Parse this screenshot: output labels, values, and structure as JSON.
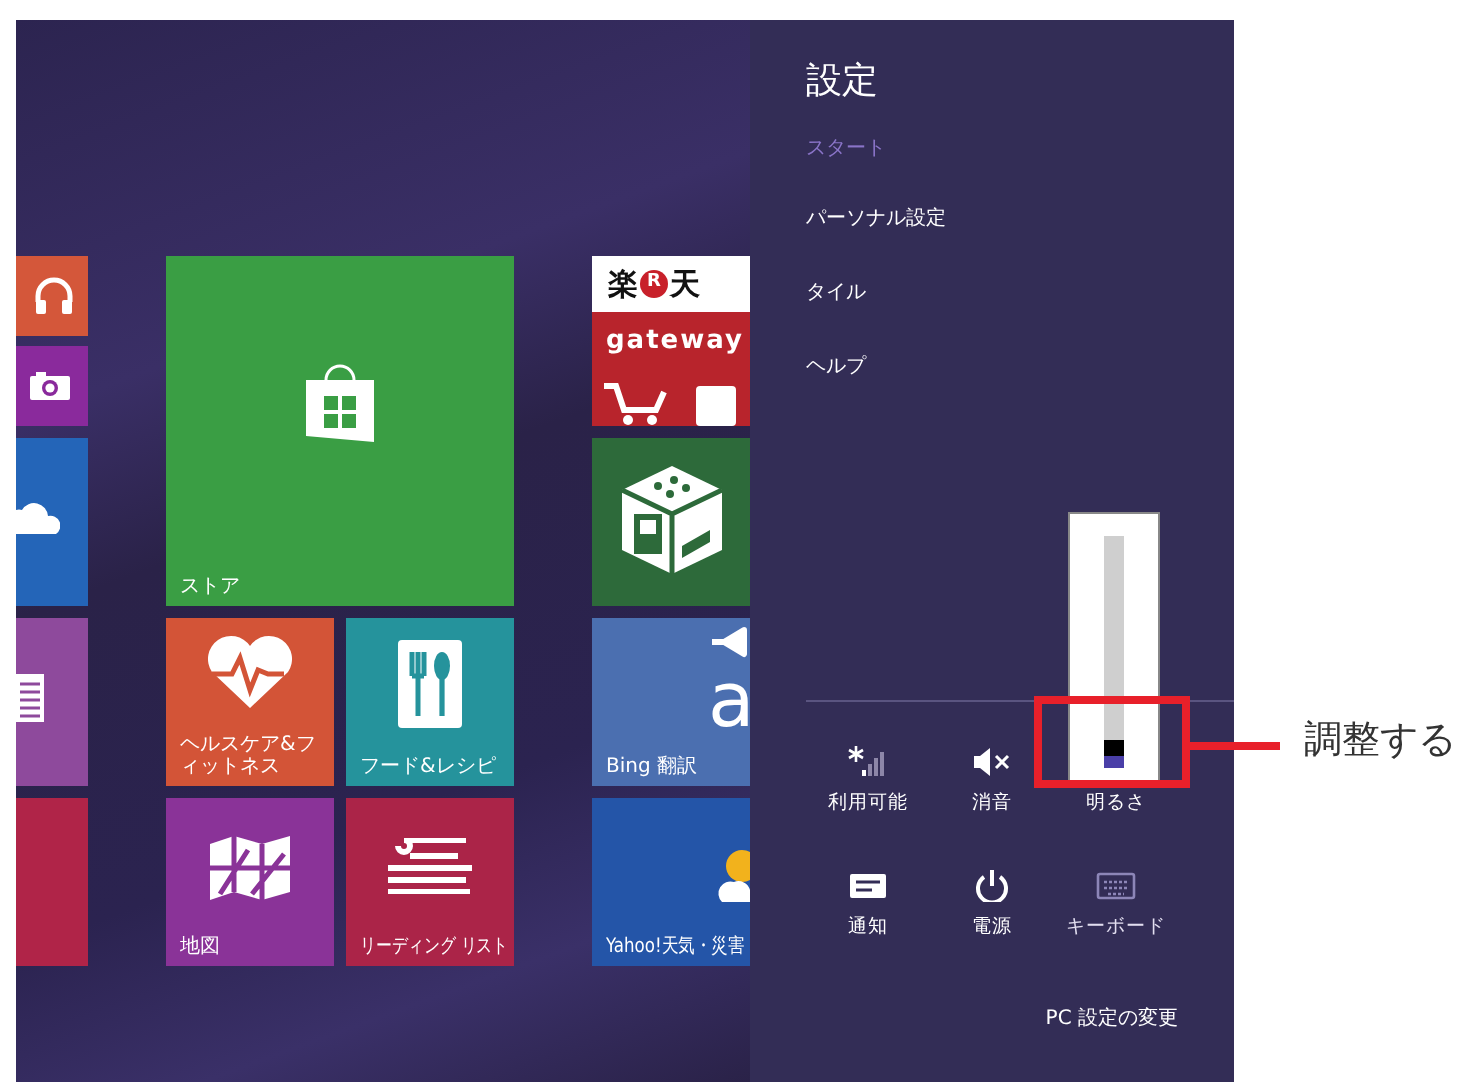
{
  "start_screen": {
    "tiles": [
      {
        "kind": "headphones",
        "color": "#d4573a"
      },
      {
        "kind": "camera",
        "color": "#8a2a9c"
      },
      {
        "kind": "cloud",
        "color": "#2465b8"
      },
      {
        "kind": "news",
        "color": "#8e4a9c"
      },
      {
        "kind": "blank",
        "color": "#b02448"
      },
      {
        "kind": "store",
        "label": "ストア",
        "color": "#3a9e44"
      },
      {
        "kind": "health",
        "label": "ヘルスケア&フィットネス",
        "color": "#d35437"
      },
      {
        "kind": "food",
        "label": "フード&レシピ",
        "color": "#25939c"
      },
      {
        "kind": "maps",
        "label": "地図",
        "color": "#8a3398"
      },
      {
        "kind": "reading",
        "label": "リーディング リスト",
        "color": "#ab2448"
      },
      {
        "kind": "rakuten",
        "logo": [
          "楽",
          "R",
          "天"
        ],
        "brand": "gateway",
        "color": "#b8242c"
      },
      {
        "kind": "cube",
        "color": "#2d6a3a"
      },
      {
        "kind": "translate",
        "glyph": "a",
        "label": "Bing 翻訳",
        "color": "#4b6fb0"
      },
      {
        "kind": "weather",
        "label": "Yahoo!天気・災害",
        "color": "#2455a8"
      }
    ]
  },
  "settings_pane": {
    "title": "設定",
    "app": "スタート",
    "menu": [
      "パーソナル設定",
      "タイル",
      "ヘルプ"
    ],
    "quick_settings": [
      {
        "kind": "network",
        "label": "利用可能",
        "disabled": false
      },
      {
        "kind": "volume",
        "label": "消音",
        "disabled": false
      },
      {
        "kind": "brightness",
        "label": "明るさ",
        "disabled": false
      },
      {
        "kind": "notifications",
        "label": "通知",
        "disabled": false
      },
      {
        "kind": "power",
        "label": "電源",
        "disabled": false
      },
      {
        "kind": "keyboard",
        "label": "キーボード",
        "disabled": true
      }
    ],
    "brightness_slider": {
      "level": 0.05
    },
    "footer_link": "PC 設定の変更"
  },
  "annotation": {
    "text": "調整する"
  }
}
